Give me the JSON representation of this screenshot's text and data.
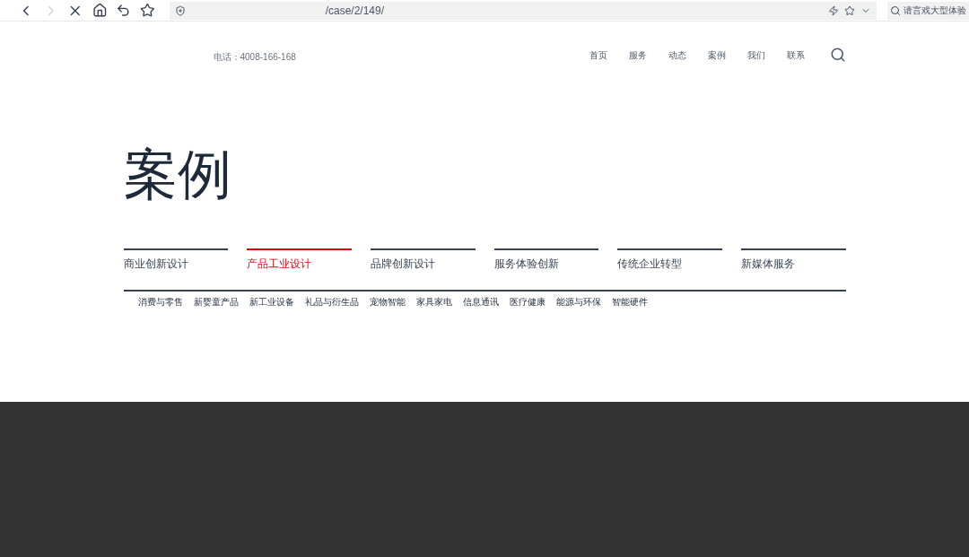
{
  "browser": {
    "url": "/case/2/149/",
    "search_placeholder": "请言戏大型体验"
  },
  "header": {
    "phone": "电话：4008-166-168",
    "nav": [
      {
        "label": "首页",
        "selected": false
      },
      {
        "label": "服务",
        "selected": false
      },
      {
        "label": "动态",
        "selected": false
      },
      {
        "label": "案例",
        "selected": false
      },
      {
        "label": "我们",
        "selected": false
      },
      {
        "label": "联系",
        "selected": false
      }
    ]
  },
  "page_title": "案例",
  "categories": [
    {
      "label": "商业创新设计",
      "selected": false
    },
    {
      "label": "产品工业设计",
      "selected": true
    },
    {
      "label": "品牌创新设计",
      "selected": false
    },
    {
      "label": "服务体验创新",
      "selected": false
    },
    {
      "label": "传统企业转型",
      "selected": false
    },
    {
      "label": "新媒体服务",
      "selected": false
    }
  ],
  "subcategories": [
    "消费与零售",
    "新婴童产品",
    "新工业设备",
    "礼品与衍生品",
    "宠物智能",
    "家具家电",
    "信息通讯",
    "医疗健康",
    "能源与环保",
    "智能硬件"
  ]
}
